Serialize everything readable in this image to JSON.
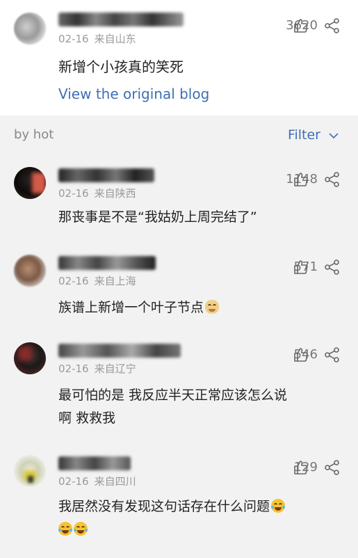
{
  "post": {
    "date": "02-16",
    "location": "来自山东",
    "likes": "3620",
    "text": "新增个小孩真的笑死",
    "view_link": "View the original blog"
  },
  "sort": {
    "label": "by hot",
    "filter_label": "Filter"
  },
  "comments": [
    {
      "date": "02-16",
      "location": "来自陕西",
      "likes": "1148",
      "text": "那丧事是不是“我姑奶上周完结了”"
    },
    {
      "date": "02-16",
      "location": "来自上海",
      "likes": "571",
      "text": "族谱上新增一个叶子节点"
    },
    {
      "date": "02-16",
      "location": "来自辽宁",
      "likes": "546",
      "text_line1": "最可怕的是 我反应半天正常应该怎么说",
      "text_line2": "啊 救救我"
    },
    {
      "date": "02-16",
      "location": "来自四川",
      "likes": "129",
      "text": "我居然没有发现这句话存在什么问题"
    }
  ],
  "icons": {
    "like": "thumbs-up-icon",
    "share": "share-icon",
    "chevron": "chevron-down-icon",
    "emoji_dog": "dog-face-emoji",
    "emoji_laugh": "laughing-tears-emoji"
  },
  "colors": {
    "link": "#3e6fb5",
    "background": "#f2f2f2",
    "card": "#ffffff",
    "meta": "#9a9a9a"
  }
}
